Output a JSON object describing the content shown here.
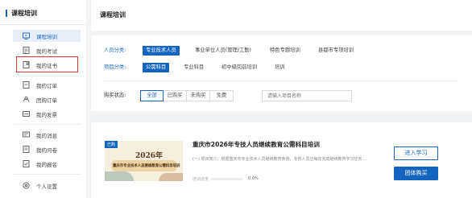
{
  "sidebar": {
    "title": "课程培训",
    "items": [
      {
        "label": "课程培训",
        "icon": "course-icon"
      },
      {
        "label": "我的考试",
        "icon": "exam-icon"
      },
      {
        "label": "我的证书",
        "icon": "certificate-icon"
      },
      {
        "label": "我的订单",
        "icon": "order-icon"
      },
      {
        "label": "团购订单",
        "icon": "group-order-icon"
      },
      {
        "label": "我的发票",
        "icon": "invoice-icon"
      },
      {
        "label": "我的消息",
        "icon": "message-icon"
      },
      {
        "label": "我的问卷",
        "icon": "survey-icon"
      },
      {
        "label": "我的报名",
        "icon": "signup-icon"
      },
      {
        "label": "个人设置",
        "icon": "settings-icon"
      }
    ]
  },
  "header": {
    "title": "课程培训"
  },
  "filters": {
    "personnel_label": "人员分类:",
    "personnel": [
      "专业技术人员",
      "事业单位人员(管理/工勤)",
      "特色专题培训",
      "县都市专项培训"
    ],
    "project_label": "项目分类:",
    "project": [
      "公需科目",
      "专业科目",
      "初中级岗前培训",
      "培训"
    ],
    "status_label": "购买状态:",
    "status": [
      "全部",
      "已购买",
      "未购买",
      "免费"
    ],
    "search_placeholder": "请输入项目名称"
  },
  "course": {
    "tag": "已购",
    "thumb_year": "2026年",
    "thumb_subtitle": "重庆市专业技术人员继续教育公需科目培训",
    "title": "重庆市2026年专技人员继续教育公需科目培训",
    "desc": "(一) 项目简介：根据重庆市专业技术人员继续教育条例，专技人员应每年完成继续教育学习任务...",
    "progress_label": "培训进度",
    "progress": 0.0,
    "progress_text": "0.0%",
    "btn_learn": "进入学习",
    "btn_group": "团体购买"
  },
  "colors": {
    "accent": "#1565c0",
    "highlight": "#e53935"
  }
}
